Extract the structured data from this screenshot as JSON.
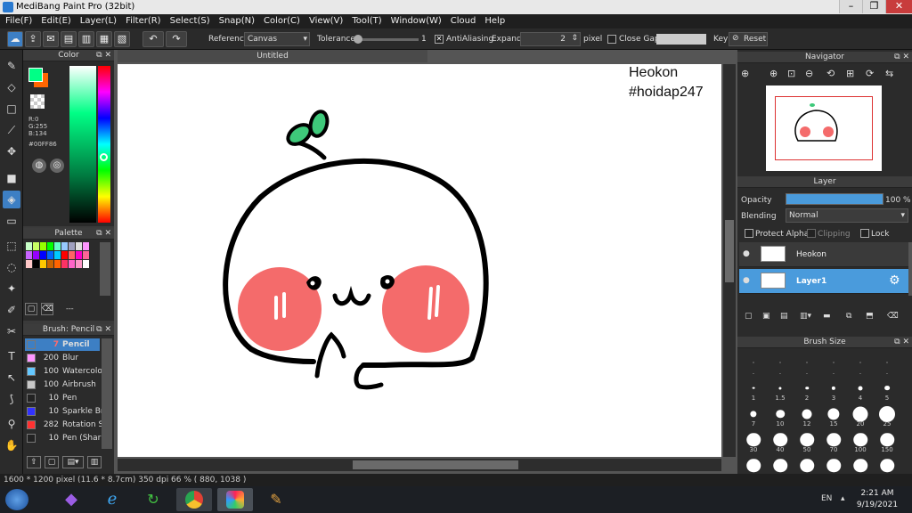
{
  "window": {
    "title": "MediBang Paint Pro (32bit)"
  },
  "menu": [
    "File(F)",
    "Edit(E)",
    "Layer(L)",
    "Filter(R)",
    "Select(S)",
    "Snap(N)",
    "Color(C)",
    "View(V)",
    "Tool(T)",
    "Window(W)",
    "Cloud",
    "Help"
  ],
  "toolbar": {
    "reference_label": "Reference",
    "reference_value": "Canvas",
    "tolerance_label": "Tolerance",
    "tolerance_value": "1",
    "antialiasing_label": "AntiAliasing",
    "expand_label": "Expand",
    "expand_value": "2",
    "expand_unit": "pixel",
    "close_gaps_label": "Close Gaps",
    "key_label": "Key",
    "reset_label": "Reset"
  },
  "color_panel": {
    "title": "Color",
    "rgb": [
      "R:0",
      "G:255",
      "B:134"
    ],
    "hex": "#00FF86",
    "fg_color": "#00ff86",
    "bg_color": "#ff6600"
  },
  "palette_panel": {
    "title": "Palette",
    "colors": [
      "#c8ffc8",
      "#c8ff64",
      "#96ff00",
      "#00ff00",
      "#64ffc8",
      "#96c8ff",
      "#a0a0c0",
      "#e0e0e0",
      "#ff96ff",
      "#c864ff",
      "#9600ff",
      "#0000ff",
      "#0064ff",
      "#00c8ff",
      "#ff0000",
      "#ff6464",
      "#ff00c8",
      "#ff6496",
      "#ffc8c8",
      "#000000",
      "#ffc800",
      "#c86400",
      "#ff6400",
      "#ff3264",
      "#ff64c8",
      "#ff96c8",
      "#ffffff"
    ],
    "footer_label": "---"
  },
  "brush_panel": {
    "title": "Brush: Pencil",
    "items": [
      {
        "size": "7",
        "name": "Pencil",
        "color": "#3d7fc4",
        "selected": true
      },
      {
        "size": "200",
        "name": "Blur",
        "color": "#ff96ff"
      },
      {
        "size": "100",
        "name": "Watercolor",
        "color": "#64c8ff"
      },
      {
        "size": "100",
        "name": "Airbrush",
        "color": "#c8c8c8"
      },
      {
        "size": "10",
        "name": "Pen",
        "color": "#222222"
      },
      {
        "size": "10",
        "name": "Sparkle Br",
        "color": "#3232ff"
      },
      {
        "size": "282",
        "name": "Rotation S",
        "color": "#ff3232"
      },
      {
        "size": "10",
        "name": "Pen (Sharp",
        "color": "#222222"
      }
    ]
  },
  "document": {
    "tab_title": "Untitled"
  },
  "canvas_text": {
    "line1": "Heokon",
    "line2": "#hoidap247"
  },
  "navigator": {
    "title": "Navigator"
  },
  "layer_panel": {
    "title": "Layer",
    "opacity_label": "Opacity",
    "opacity_value": "100 %",
    "opacity_percent": 100,
    "blending_label": "Blending",
    "blending_value": "Normal",
    "protect_alpha_label": "Protect Alpha",
    "clipping_label": "Clipping",
    "lock_label": "Lock",
    "layers": [
      {
        "name": "Heokon",
        "selected": false
      },
      {
        "name": "Layer1",
        "selected": true
      }
    ]
  },
  "brush_size_panel": {
    "title": "Brush Size",
    "sizes": [
      ".",
      ".",
      ".",
      ".",
      ".",
      ".",
      "1",
      "1.5",
      "2",
      "3",
      "4",
      "5",
      "7",
      "10",
      "12",
      "15",
      "20",
      "25",
      "30",
      "40",
      "50",
      "70",
      "100",
      "150",
      "",
      "",
      "",
      "",
      "",
      ""
    ]
  },
  "status": {
    "text": "1600 * 1200 pixel  (11.6 * 8.7cm)  350 dpi  66 %  ( 880, 1038 )"
  },
  "taskbar": {
    "lang": "EN",
    "time": "2:21 AM",
    "date": "9/19/2021"
  }
}
